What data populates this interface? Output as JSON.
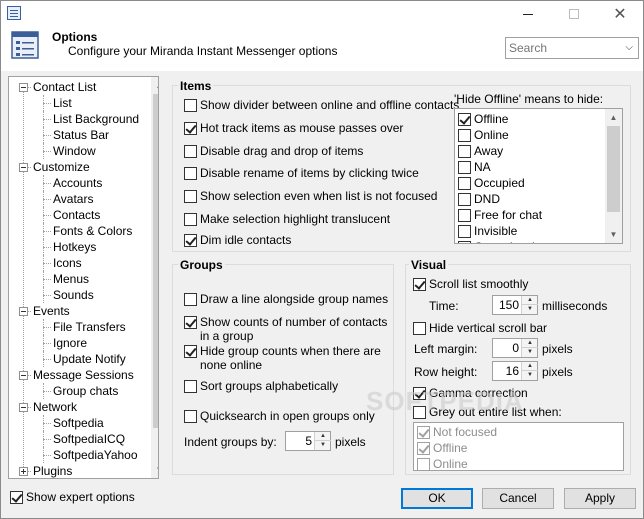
{
  "window": {
    "title": ""
  },
  "header": {
    "title": "Options",
    "subtitle": "Configure your Miranda Instant Messenger options",
    "search_placeholder": "Search"
  },
  "tree": {
    "items": [
      {
        "label": "Contact List",
        "level": 0,
        "expanded": true
      },
      {
        "label": "List",
        "level": 1
      },
      {
        "label": "List Background",
        "level": 1
      },
      {
        "label": "Status Bar",
        "level": 1
      },
      {
        "label": "Window",
        "level": 1
      },
      {
        "label": "Customize",
        "level": 0,
        "expanded": true
      },
      {
        "label": "Accounts",
        "level": 1
      },
      {
        "label": "Avatars",
        "level": 1
      },
      {
        "label": "Contacts",
        "level": 1
      },
      {
        "label": "Fonts & Colors",
        "level": 1
      },
      {
        "label": "Hotkeys",
        "level": 1
      },
      {
        "label": "Icons",
        "level": 1
      },
      {
        "label": "Menus",
        "level": 1
      },
      {
        "label": "Sounds",
        "level": 1
      },
      {
        "label": "Events",
        "level": 0,
        "expanded": true
      },
      {
        "label": "File Transfers",
        "level": 1
      },
      {
        "label": "Ignore",
        "level": 1
      },
      {
        "label": "Update Notify",
        "level": 1
      },
      {
        "label": "Message Sessions",
        "level": 0,
        "expanded": true
      },
      {
        "label": "Group chats",
        "level": 1
      },
      {
        "label": "Network",
        "level": 0,
        "expanded": true
      },
      {
        "label": "Softpedia",
        "level": 1
      },
      {
        "label": "SoftpediaICQ",
        "level": 1
      },
      {
        "label": "SoftpediaYahoo",
        "level": 1
      },
      {
        "label": "Plugins",
        "level": 0,
        "expanded": false
      }
    ]
  },
  "items": {
    "title": "Items",
    "options": [
      {
        "label": "Show divider between online and offline contacts",
        "checked": false
      },
      {
        "label": "Hot track items as mouse passes over",
        "checked": true
      },
      {
        "label": "Disable drag and drop of items",
        "checked": false
      },
      {
        "label": "Disable rename of items by clicking twice",
        "checked": false
      },
      {
        "label": "Show selection even when list is not focused",
        "checked": false
      },
      {
        "label": "Make selection highlight translucent",
        "checked": false
      },
      {
        "label": "Dim idle contacts",
        "checked": true
      }
    ],
    "hide_offline_label": "'Hide Offline' means to hide:",
    "hide_offline_list": [
      {
        "label": "Offline",
        "checked": true
      },
      {
        "label": "Online",
        "checked": false
      },
      {
        "label": "Away",
        "checked": false
      },
      {
        "label": "NA",
        "checked": false
      },
      {
        "label": "Occupied",
        "checked": false
      },
      {
        "label": "DND",
        "checked": false
      },
      {
        "label": "Free for chat",
        "checked": false
      },
      {
        "label": "Invisible",
        "checked": false
      },
      {
        "label": "Out to lunch",
        "checked": false
      }
    ]
  },
  "groups": {
    "title": "Groups",
    "options": [
      {
        "label": "Draw a line alongside group names",
        "checked": false
      },
      {
        "label": "Show counts of number of contacts in a group",
        "checked": true
      },
      {
        "label": "Hide group counts when there are none online",
        "checked": true
      },
      {
        "label": "Sort groups alphabetically",
        "checked": false
      },
      {
        "label": "Quicksearch in open groups only",
        "checked": false
      }
    ],
    "indent_label": "Indent groups by:",
    "indent_value": "5",
    "indent_unit": "pixels"
  },
  "visual": {
    "title": "Visual",
    "scroll_smoothly": {
      "label": "Scroll list smoothly",
      "checked": true
    },
    "time_label": "Time:",
    "time_value": "150",
    "time_unit": "milliseconds",
    "hide_scrollbar": {
      "label": "Hide vertical scroll bar",
      "checked": false
    },
    "left_margin_label": "Left margin:",
    "left_margin_value": "0",
    "left_margin_unit": "pixels",
    "row_height_label": "Row height:",
    "row_height_value": "16",
    "row_height_unit": "pixels",
    "gamma": {
      "label": "Gamma correction",
      "checked": true
    },
    "grey_out": {
      "label": "Grey out entire list when:",
      "checked": false
    },
    "grey_list": [
      {
        "label": "Not focused",
        "checked": true
      },
      {
        "label": "Offline",
        "checked": true
      },
      {
        "label": "Online",
        "checked": false
      }
    ]
  },
  "footer": {
    "expert_label": "Show expert options",
    "expert_checked": true,
    "ok": "OK",
    "cancel": "Cancel",
    "apply": "Apply"
  },
  "watermark": "SOFTPEDIA",
  "colors": {
    "accent": "#0078d7",
    "background": "#f0f0f0",
    "border": "#a0a0a0"
  }
}
